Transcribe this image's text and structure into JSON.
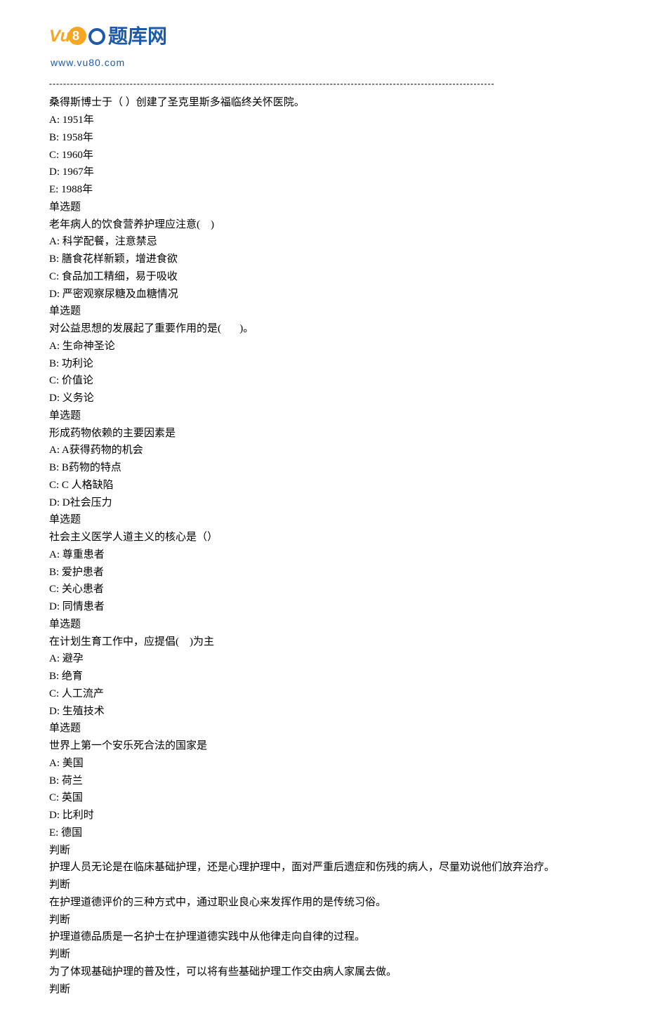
{
  "logo": {
    "text": "题库网",
    "url": "www.vu80.com"
  },
  "divider": "-------------------------------------------------------------------------------------------------------------------------------",
  "questions": [
    {
      "stem": "桑得斯博士于（ ）创建了圣克里斯多福临终关怀医院。",
      "options": [
        "A: 1951年",
        "B: 1958年",
        "C: 1960年",
        "D: 1967年",
        "E: 1988年"
      ],
      "type": "单选题"
    },
    {
      "stem": "老年病人的饮食营养护理应注意(　)",
      "options": [
        "A: 科学配餐，注意禁忌",
        "B: 膳食花样新颖，增进食欲",
        "C: 食品加工精细，易于吸收",
        "D: 严密观察尿糖及血糖情况"
      ],
      "type": "单选题"
    },
    {
      "stem": "对公益思想的发展起了重要作用的是(       )。",
      "options": [
        "A: 生命神圣论",
        "B: 功利论",
        "C: 价值论",
        "D: 义务论"
      ],
      "type": "单选题"
    },
    {
      "stem": "形成药物依赖的主要因素是",
      "options": [
        "A: A获得药物的机会",
        "B: B药物的特点",
        "C: C 人格缺陷",
        "D: D社会压力"
      ],
      "type": "单选题"
    },
    {
      "stem": "社会主义医学人道主义的核心是（）",
      "options": [
        "A: 尊重患者",
        "B: 爱护患者",
        "C: 关心患者",
        "D: 同情患者"
      ],
      "type": "单选题"
    },
    {
      "stem": "在计划生育工作中，应提倡(　)为主",
      "options": [
        "A: 避孕",
        "B: 绝育",
        "C: 人工流产",
        "D: 生殖技术"
      ],
      "type": "单选题"
    },
    {
      "stem": "世界上第一个安乐死合法的国家是",
      "options": [
        "A: 美国",
        "B: 荷兰",
        "C: 英国",
        "D: 比利时",
        "E: 德国"
      ],
      "type": "判断"
    }
  ],
  "judgments": [
    "护理人员无论是在临床基础护理，还是心理护理中，面对严重后遗症和伤残的病人，尽量劝说他们放弃治疗。",
    "判断",
    "在护理道德评价的三种方式中，通过职业良心来发挥作用的是传统习俗。",
    "判断",
    "护理道德品质是一名护士在护理道德实践中从他律走向自律的过程。",
    "判断",
    "为了体现基础护理的普及性，可以将有些基础护理工作交由病人家属去做。",
    "判断"
  ]
}
